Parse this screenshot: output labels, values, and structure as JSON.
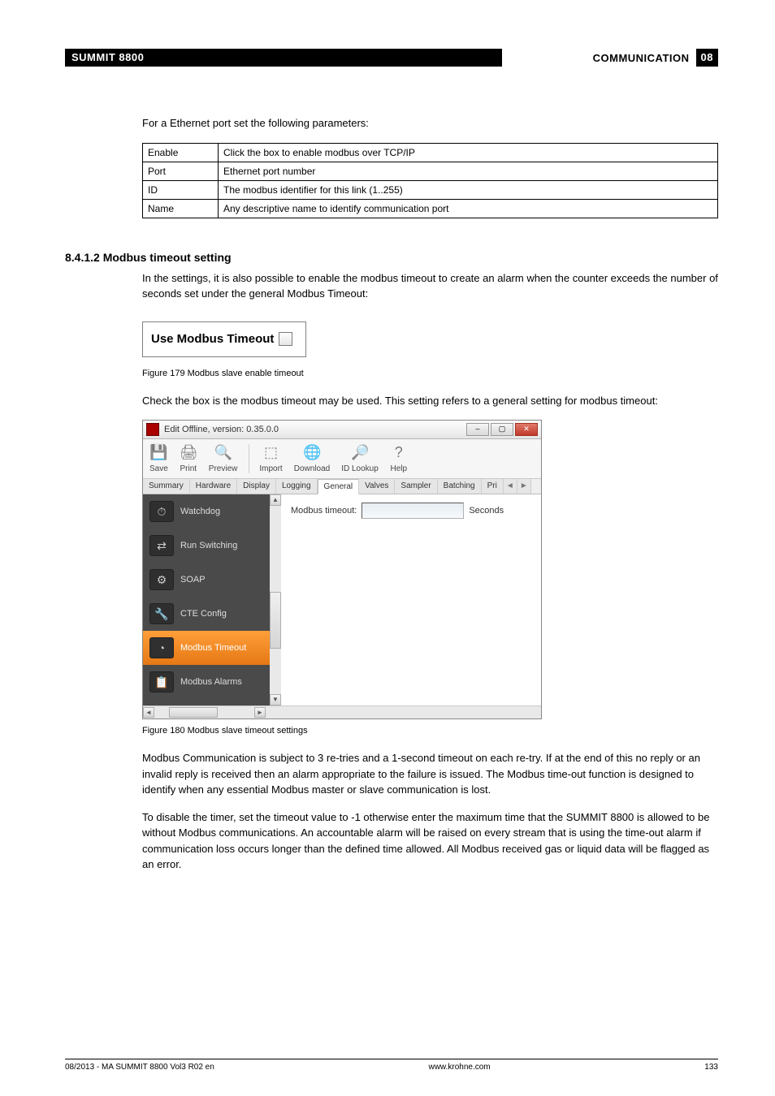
{
  "header": {
    "product": "SUMMIT 8800",
    "section": "COMMUNICATION",
    "chapter": "08"
  },
  "intro": "For a Ethernet port set the following parameters:",
  "params": [
    {
      "k": "Enable",
      "v": "Click the box to enable modbus over TCP/IP"
    },
    {
      "k": "Port",
      "v": "Ethernet port number"
    },
    {
      "k": "ID",
      "v": "The modbus identifier for this link (1..255)"
    },
    {
      "k": "Name",
      "v": "Any descriptive name to identify communication port"
    }
  ],
  "section_heading": "8.4.1.2 Modbus timeout setting",
  "p1": "In the settings, it is also possible to enable the modbus timeout to create an alarm when the counter exceeds the number of seconds set under the general Modbus Timeout:",
  "fig179": {
    "label": "Use Modbus Timeout",
    "caption": "Figure 179    Modbus slave enable timeout"
  },
  "p2": "Check the box is the modbus timeout may be used. This setting refers to a general setting for modbus timeout:",
  "win": {
    "title": "Edit Offline, version: 0.35.0.0",
    "toolbar": [
      {
        "name": "save-icon",
        "label": "Save",
        "glyph": "💾"
      },
      {
        "name": "print-icon",
        "label": "Print",
        "glyph": "🖨"
      },
      {
        "name": "preview-icon",
        "label": "Preview",
        "glyph": "🔍"
      },
      {
        "name": "import-icon",
        "label": "Import",
        "glyph": "⬚"
      },
      {
        "name": "download-icon",
        "label": "Download",
        "glyph": "🌐"
      },
      {
        "name": "idlookup-icon",
        "label": "ID Lookup",
        "glyph": "🔎"
      },
      {
        "name": "help-icon",
        "label": "Help",
        "glyph": "?"
      }
    ],
    "tabs": [
      "Summary",
      "Hardware",
      "Display",
      "Logging",
      "General",
      "Valves",
      "Sampler",
      "Batching",
      "Pri"
    ],
    "active_tab": 4,
    "nav": [
      {
        "name": "nav-watchdog",
        "label": "Watchdog",
        "glyph": "⏱"
      },
      {
        "name": "nav-runswitching",
        "label": "Run Switching",
        "glyph": "⇄"
      },
      {
        "name": "nav-soap",
        "label": "SOAP",
        "glyph": "⚙"
      },
      {
        "name": "nav-cteconfig",
        "label": "CTE Config",
        "glyph": "🔧"
      },
      {
        "name": "nav-modbustimeout",
        "label": "Modbus Timeout",
        "glyph": "◔",
        "selected": true
      },
      {
        "name": "nav-modbusalarms",
        "label": "Modbus Alarms",
        "glyph": "📋"
      }
    ],
    "field": {
      "label": "Modbus timeout:",
      "unit": "Seconds"
    }
  },
  "fig180_caption": "Figure 180    Modbus slave timeout settings",
  "p3": "Modbus Communication is subject to 3 re-tries and a 1-second timeout on each re-try. If at the end of this no reply or an invalid reply is received then an alarm appropriate to the failure is issued. The Modbus time-out function is designed to identify when any essential Modbus master or slave communication is lost.",
  "p4": "To disable the timer, set the timeout value to -1 otherwise enter the maximum time that the SUMMIT 8800 is allowed to be without Modbus communications. An accountable alarm will be raised on every stream that is using the time-out alarm if communication loss occurs longer than the defined time allowed. All Modbus received gas or liquid data will be flagged as an error.",
  "footer": {
    "left": "08/2013 - MA SUMMIT 8800 Vol3 R02 en",
    "center": "www.krohne.com",
    "right": "133"
  }
}
